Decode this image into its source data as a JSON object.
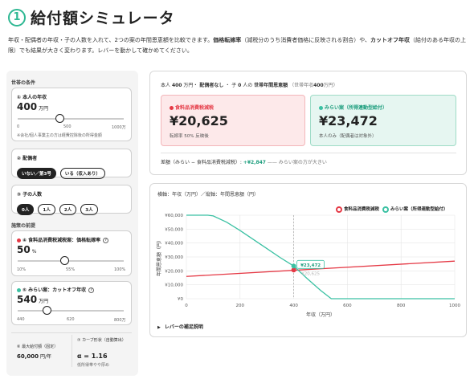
{
  "header": {
    "number": "1",
    "title": "給付額シミュレータ"
  },
  "intro": {
    "p1": "年収・配偶者の年収・子の人数を入れて、2つの案の年間恩恵額を比較できます。",
    "b1": "価格転嫁率",
    "p2": "（減税分のうち消費者価格に反映される割合）や、",
    "b2": "カットオフ年収",
    "p3": "（給付のある年収の上限）でも結果が大きく変わります。レバーを動かして確かめてください。"
  },
  "household": {
    "section_label": "世帯の条件",
    "income": {
      "title": "① 本人の年収",
      "value": "400",
      "unit": "万円",
      "ticks": [
        "0",
        "500",
        "1000万"
      ],
      "note": "※会社/個人事業主の方は経費控除後の所得金額",
      "slider_fraction": 0.4
    },
    "spouse": {
      "title": "② 配偶者",
      "options": [
        "いない／第3号",
        "いる（収入あり）"
      ],
      "selected": 0
    },
    "children": {
      "title": "③ 子の人数",
      "options": [
        "0人",
        "1人",
        "2人",
        "3人"
      ],
      "selected": 0
    }
  },
  "policy": {
    "section_label": "施策の前提",
    "pass_through": {
      "title": "④ 食料品消費税減税案：価格転嫁率",
      "help": "?",
      "value": "50",
      "unit": "%",
      "ticks": [
        "10%",
        "55%",
        "100%"
      ],
      "slider_fraction": 0.444
    },
    "cutoff": {
      "title": "⑤ みらい案：カットオフ年収",
      "help": "?",
      "value": "540",
      "unit": "万円",
      "ticks": [
        "440",
        "620",
        "800万"
      ],
      "slider_fraction": 0.278
    },
    "max_benefit": {
      "title": "⑥ 最大給付額（固定）",
      "value": "60,000",
      "unit": "円/年"
    },
    "curve": {
      "title": "⑦ カーブ形状（自動算出）",
      "value": "α = 1.16",
      "note": "低所得帯やや厚め"
    }
  },
  "summary": {
    "income_label": "本人",
    "income_value": "400",
    "income_unit": "万円・",
    "spouse_text": "配偶者なし",
    "sep1": "・ 子",
    "children_value": "0",
    "children_unit": "人の",
    "benefit_label": "世帯年間恩恵額",
    "annual_note": "（世帯年収",
    "annual_value": "400",
    "annual_unit": "万円）"
  },
  "results": {
    "food": {
      "name": "食料品消費税減税",
      "value": "¥20,625",
      "sub": "転嫁率 50% 反映後"
    },
    "mirai": {
      "name": "みらい案（所得連動型給付）",
      "value": "¥23,472",
      "sub": "本人のみ（配偶者は対象外）"
    }
  },
  "difference": {
    "label": "差額（みらい − 食料品消費税減税）:",
    "value": "+¥2,847",
    "note": "—— みらい案の方が大きい"
  },
  "chart_meta": {
    "axes_note": "横軸：年収（万円）／縦軸：年間恩恵額（円）",
    "supplement": "レバーの補足説明",
    "expand_icon": "▶"
  },
  "colors": {
    "food": "#e53945",
    "mirai": "#3bc1a3",
    "accent": "#2fb893"
  },
  "chart_data": {
    "type": "line",
    "xlabel": "年収（万円）",
    "ylabel": "年間恩恵額（円）",
    "xlim": [
      0,
      1000
    ],
    "ylim": [
      0,
      60000
    ],
    "xticks": [
      0,
      200,
      400,
      600,
      800,
      1000
    ],
    "yticks": [
      0,
      10000,
      20000,
      30000,
      40000,
      50000,
      60000
    ],
    "ytick_labels": [
      "¥0",
      "¥10,000",
      "¥20,000",
      "¥30,000",
      "¥40,000",
      "¥50,000",
      "¥60,000"
    ],
    "grid": true,
    "legend_position": "top-right",
    "series": [
      {
        "name": "食料品消費税減税",
        "x": [
          0,
          1000
        ],
        "y": [
          16000,
          27000
        ]
      },
      {
        "name": "みらい案（所得連動型給付）",
        "x": [
          0,
          80,
          100,
          150,
          200,
          250,
          300,
          350,
          400,
          450,
          500,
          540,
          600,
          800,
          1000
        ],
        "y": [
          60000,
          60000,
          59500,
          55000,
          49000,
          42500,
          36000,
          29500,
          23472,
          14500,
          6000,
          0,
          0,
          0,
          0
        ]
      }
    ],
    "markers": [
      {
        "series": "食料品消費税減税",
        "x": 400,
        "y": 20625,
        "label": "¥20,625"
      },
      {
        "series": "みらい案（所得連動型給付）",
        "x": 400,
        "y": 23472,
        "label": "¥23,472"
      }
    ]
  }
}
